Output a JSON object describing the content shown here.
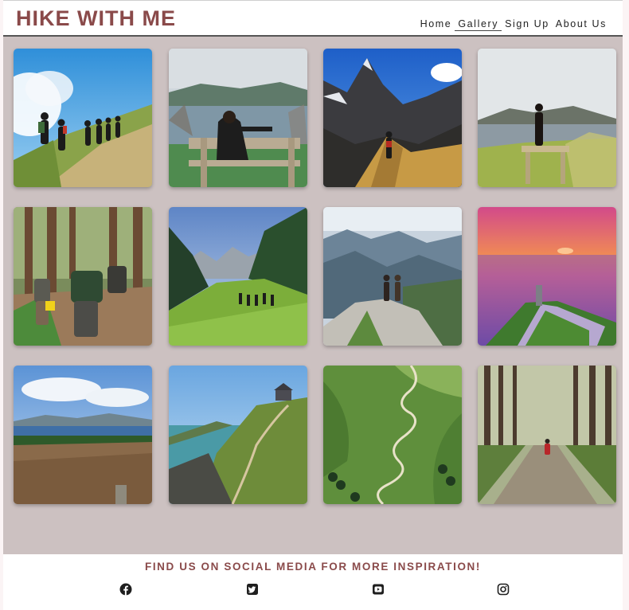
{
  "header": {
    "logo": "HIKE WITH ME",
    "nav": [
      {
        "label": "Home",
        "active": false
      },
      {
        "label": "Gallery",
        "active": true
      },
      {
        "label": "Sign Up",
        "active": false
      },
      {
        "label": "About Us",
        "active": false
      }
    ]
  },
  "gallery": {
    "background": "#ccc1c1",
    "images": [
      {
        "icon": "hikers-group-hillside-photo"
      },
      {
        "icon": "woman-on-bench-lake-photo"
      },
      {
        "icon": "hiker-mountain-ridge-photo"
      },
      {
        "icon": "woman-standing-on-bench-photo"
      },
      {
        "icon": "backpackers-forest-path-photo"
      },
      {
        "icon": "hikers-green-valley-photo"
      },
      {
        "icon": "couple-on-rock-mountains-photo"
      },
      {
        "icon": "sunset-lighthouse-sea-photo"
      },
      {
        "icon": "coastal-heath-view-photo"
      },
      {
        "icon": "cliff-path-hut-photo"
      },
      {
        "icon": "winding-mountain-road-photo"
      },
      {
        "icon": "pine-forest-trail-photo"
      }
    ]
  },
  "footer": {
    "title": "FIND US ON SOCIAL MEDIA FOR MORE INSPIRATION!",
    "social": [
      {
        "icon": "facebook-icon"
      },
      {
        "icon": "twitter-icon"
      },
      {
        "icon": "youtube-icon"
      },
      {
        "icon": "instagram-icon"
      }
    ]
  },
  "colors": {
    "brand": "#8a4a4a",
    "gallery_bg": "#ccc1c1",
    "nav_text": "#222222"
  }
}
